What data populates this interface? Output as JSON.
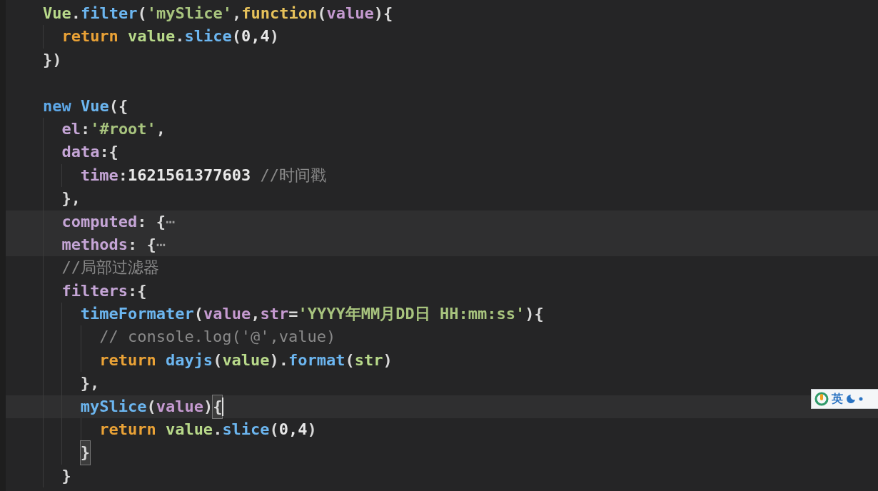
{
  "editor": {
    "lines": [
      {
        "kind": "code",
        "tokens": [
          {
            "kind": "global",
            "text": "Vue"
          },
          {
            "kind": "punct",
            "text": "."
          },
          {
            "kind": "func",
            "text": "filter"
          },
          {
            "kind": "punct",
            "text": "("
          },
          {
            "kind": "string",
            "text": "'mySlice'"
          },
          {
            "kind": "punct",
            "text": ","
          },
          {
            "kind": "storage",
            "text": "function"
          },
          {
            "kind": "punct",
            "text": "("
          },
          {
            "kind": "param",
            "text": "value"
          },
          {
            "kind": "punct",
            "text": "){"
          }
        ],
        "children": [
          {
            "kind": "code",
            "tokens": [
              {
                "kind": "keyword",
                "text": "return "
              },
              {
                "kind": "global",
                "text": "value"
              },
              {
                "kind": "punct",
                "text": "."
              },
              {
                "kind": "func",
                "text": "slice"
              },
              {
                "kind": "punct",
                "text": "("
              },
              {
                "kind": "number",
                "text": "0,4"
              },
              {
                "kind": "punct",
                "text": ")"
              }
            ]
          }
        ]
      },
      {
        "kind": "code",
        "tokens": [
          {
            "kind": "punct",
            "text": "})"
          }
        ]
      },
      {
        "kind": "blank"
      },
      {
        "kind": "code",
        "tokens": [
          {
            "kind": "new",
            "text": "new "
          },
          {
            "kind": "func",
            "text": "Vue"
          },
          {
            "kind": "punct",
            "text": "({"
          }
        ],
        "children": [
          {
            "kind": "code",
            "tokens": [
              {
                "kind": "prop",
                "text": "el"
              },
              {
                "kind": "punct",
                "text": ":"
              },
              {
                "kind": "string",
                "text": "'#root'"
              },
              {
                "kind": "punct",
                "text": ","
              }
            ]
          },
          {
            "kind": "code",
            "tokens": [
              {
                "kind": "prop",
                "text": "data"
              },
              {
                "kind": "punct",
                "text": ":{"
              }
            ],
            "children": [
              {
                "kind": "code",
                "tokens": [
                  {
                    "kind": "prop",
                    "text": "time"
                  },
                  {
                    "kind": "punct",
                    "text": ":"
                  },
                  {
                    "kind": "number",
                    "text": "1621561377603 "
                  },
                  {
                    "kind": "comment",
                    "text": "//时间戳"
                  }
                ]
              }
            ]
          },
          {
            "kind": "code",
            "tokens": [
              {
                "kind": "punct",
                "text": "},"
              }
            ]
          },
          {
            "kind": "code",
            "highlighted": true,
            "tokens": [
              {
                "kind": "prop",
                "text": "computed"
              },
              {
                "kind": "punct",
                "text": ": {"
              },
              {
                "kind": "fold",
                "text": "⋯"
              }
            ]
          },
          {
            "kind": "code",
            "highlighted": true,
            "tokens": [
              {
                "kind": "prop",
                "text": "methods"
              },
              {
                "kind": "punct",
                "text": ": {"
              },
              {
                "kind": "fold",
                "text": "⋯"
              }
            ]
          },
          {
            "kind": "code",
            "tokens": [
              {
                "kind": "comment",
                "text": "//局部过滤器"
              }
            ]
          },
          {
            "kind": "code",
            "tokens": [
              {
                "kind": "prop",
                "text": "filters"
              },
              {
                "kind": "punct",
                "text": ":{"
              }
            ],
            "children": [
              {
                "kind": "code",
                "tokens": [
                  {
                    "kind": "func",
                    "text": "timeFormater"
                  },
                  {
                    "kind": "punct",
                    "text": "("
                  },
                  {
                    "kind": "param",
                    "text": "value"
                  },
                  {
                    "kind": "punct",
                    "text": ","
                  },
                  {
                    "kind": "param",
                    "text": "str"
                  },
                  {
                    "kind": "punct",
                    "text": "="
                  },
                  {
                    "kind": "string",
                    "text": "'YYYY年MM月DD日 HH:mm:ss'"
                  },
                  {
                    "kind": "punct",
                    "text": "){"
                  }
                ],
                "children": [
                  {
                    "kind": "code",
                    "tokens": [
                      {
                        "kind": "comment",
                        "text": "// console.log('@',value)"
                      }
                    ]
                  },
                  {
                    "kind": "code",
                    "tokens": [
                      {
                        "kind": "keyword",
                        "text": "return "
                      },
                      {
                        "kind": "func",
                        "text": "dayjs"
                      },
                      {
                        "kind": "punct",
                        "text": "("
                      },
                      {
                        "kind": "global",
                        "text": "value"
                      },
                      {
                        "kind": "punct",
                        "text": ")."
                      },
                      {
                        "kind": "func",
                        "text": "format"
                      },
                      {
                        "kind": "punct",
                        "text": "("
                      },
                      {
                        "kind": "global",
                        "text": "str"
                      },
                      {
                        "kind": "punct",
                        "text": ")"
                      }
                    ]
                  }
                ]
              },
              {
                "kind": "code",
                "tokens": [
                  {
                    "kind": "punct",
                    "text": "},"
                  }
                ]
              },
              {
                "kind": "code",
                "highlighted": true,
                "cursor": true,
                "tokens": [
                  {
                    "kind": "func",
                    "text": "mySlice"
                  },
                  {
                    "kind": "punct",
                    "text": "("
                  },
                  {
                    "kind": "param",
                    "text": "value"
                  },
                  {
                    "kind": "punct",
                    "text": ")"
                  },
                  {
                    "kind": "punct",
                    "text": "{",
                    "matched": true
                  }
                ],
                "children": [
                  {
                    "kind": "code",
                    "tokens": [
                      {
                        "kind": "keyword",
                        "text": "return "
                      },
                      {
                        "kind": "global",
                        "text": "value"
                      },
                      {
                        "kind": "punct",
                        "text": "."
                      },
                      {
                        "kind": "func",
                        "text": "slice"
                      },
                      {
                        "kind": "punct",
                        "text": "("
                      },
                      {
                        "kind": "number",
                        "text": "0,4"
                      },
                      {
                        "kind": "punct",
                        "text": ")"
                      }
                    ]
                  }
                ]
              },
              {
                "kind": "code",
                "tokens": [
                  {
                    "kind": "punct",
                    "text": "}",
                    "matched": true
                  }
                ]
              }
            ]
          },
          {
            "kind": "code",
            "tokens": [
              {
                "kind": "punct",
                "text": "}"
              }
            ]
          }
        ]
      }
    ]
  },
  "ime_toolbar": {
    "mode": "英"
  }
}
